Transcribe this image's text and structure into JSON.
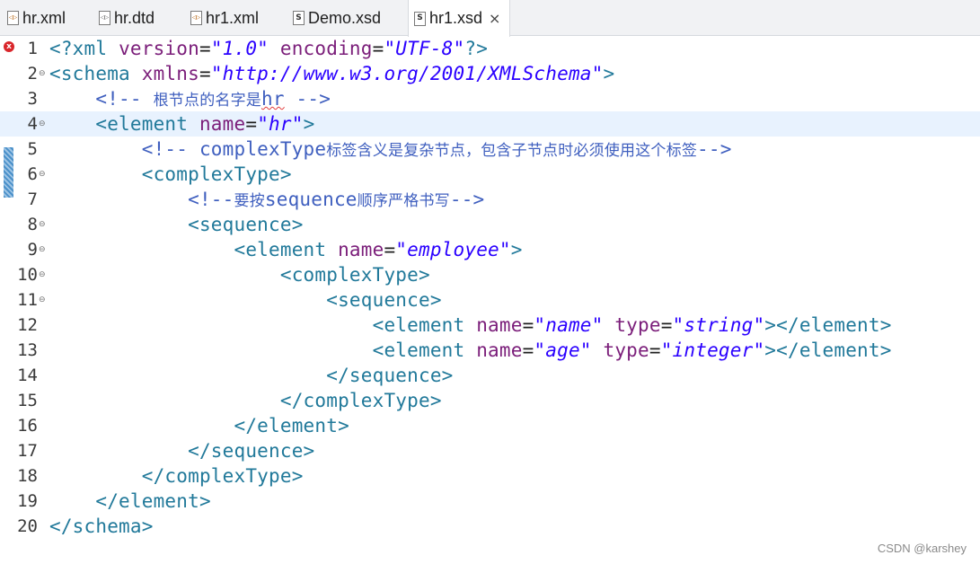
{
  "tabs": [
    {
      "label": "hr.xml",
      "icon": "xml-file-icon"
    },
    {
      "label": "hr.dtd",
      "icon": "dtd-file-icon"
    },
    {
      "label": "hr1.xml",
      "icon": "xml-file-icon"
    },
    {
      "label": "Demo.xsd",
      "icon": "xsd-file-icon"
    },
    {
      "label": "hr1.xsd",
      "icon": "xsd-file-icon",
      "active": true,
      "close": "×"
    }
  ],
  "editor": {
    "current_line": 4,
    "lines": [
      {
        "n": "1",
        "fold": "",
        "err": true
      },
      {
        "n": "2",
        "fold": "⊖"
      },
      {
        "n": "3",
        "fold": ""
      },
      {
        "n": "4",
        "fold": "⊖"
      },
      {
        "n": "5",
        "fold": ""
      },
      {
        "n": "6",
        "fold": "⊖"
      },
      {
        "n": "7",
        "fold": ""
      },
      {
        "n": "8",
        "fold": "⊖"
      },
      {
        "n": "9",
        "fold": "⊖"
      },
      {
        "n": "10",
        "fold": "⊖"
      },
      {
        "n": "11",
        "fold": "⊖"
      },
      {
        "n": "12",
        "fold": ""
      },
      {
        "n": "13",
        "fold": ""
      },
      {
        "n": "14",
        "fold": ""
      },
      {
        "n": "15",
        "fold": ""
      },
      {
        "n": "16",
        "fold": ""
      },
      {
        "n": "17",
        "fold": ""
      },
      {
        "n": "18",
        "fold": ""
      },
      {
        "n": "19",
        "fold": ""
      },
      {
        "n": "20",
        "fold": ""
      }
    ],
    "code": {
      "l1": {
        "a": "<?xml ",
        "b": "version",
        "c": "=",
        "d": "\"1.0\"",
        "e": " ",
        "f": "encoding",
        "g": "=",
        "h": "\"UTF-8\"",
        "i": "?>"
      },
      "l2": {
        "a": "<schema ",
        "b": "xmlns",
        "c": "=",
        "d": "\"http://www.w3.org/2001/XMLSchema\"",
        "e": ">"
      },
      "l3": {
        "a": "    <!-- ",
        "b": "根节点的名字是",
        "c": "hr",
        "d": " -->"
      },
      "l4": {
        "a": "    <",
        "b": "element ",
        "c": "name",
        "d": "=",
        "e": "\"hr\"",
        "f": ">"
      },
      "l5": {
        "a": "        <!-- complexType",
        "b": "标签含义是复杂节点，包含子节点时必须使用这个标签",
        "c": "-->"
      },
      "l6": {
        "a": "        <complexType>"
      },
      "l7": {
        "a": "            <!--",
        "b": "要按",
        "c": "sequence",
        "d": "顺序严格书写",
        "e": "-->"
      },
      "l8": {
        "a": "            <sequence>"
      },
      "l9": {
        "a": "                <element ",
        "b": "name",
        "c": "=",
        "d": "\"employee\"",
        "e": ">"
      },
      "l10": {
        "a": "                    <complexType>"
      },
      "l11": {
        "a": "                        <sequence>"
      },
      "l12": {
        "a": "                            <element ",
        "b": "name",
        "c": "=",
        "d": "\"name\"",
        "e": " ",
        "f": "type",
        "g": "=",
        "h": "\"string\"",
        "i": "></element>"
      },
      "l13": {
        "a": "                            <element ",
        "b": "name",
        "c": "=",
        "d": "\"age\"",
        "e": " ",
        "f": "type",
        "g": "=",
        "h": "\"integer\"",
        "i": "></element>"
      },
      "l14": {
        "a": "                        </sequence>"
      },
      "l15": {
        "a": "                    </complexType>"
      },
      "l16": {
        "a": "                </element>"
      },
      "l17": {
        "a": "            </sequence>"
      },
      "l18": {
        "a": "        </complexType>"
      },
      "l19": {
        "a": "    </element>"
      },
      "l20": {
        "a": "</schema>"
      }
    }
  },
  "watermark": "CSDN @karshey"
}
